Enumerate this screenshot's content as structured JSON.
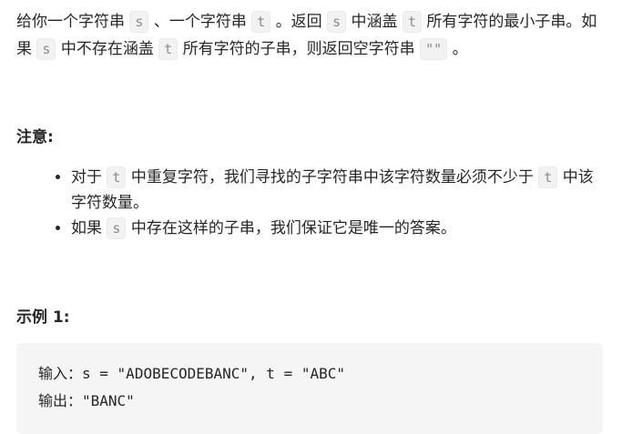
{
  "intro": {
    "t1": "给你一个字符串",
    "s1": "s",
    "t2": "、一个字符串",
    "tvar1": "t",
    "t3": "。返回",
    "s2": "s",
    "t4": "中涵盖",
    "tvar2": "t",
    "t5": "所有字符的最小子串。如果",
    "s3": "s",
    "t6": "中不存在涵盖",
    "tvar3": "t",
    "t7": "所有字符的子串，则返回空字符串",
    "empty": "\"\"",
    "t8": "。"
  },
  "note_heading": "注意:",
  "notes": [
    {
      "a": "对于",
      "c1": "t",
      "b": "中重复字符，我们寻找的子字符串中该字符数量必须不少于",
      "c2": "t",
      "d": "中该字符数量。"
    },
    {
      "a": "如果",
      "c1": "s",
      "b": "中存在这样的子串，我们保证它是唯一的答案。"
    }
  ],
  "example_heading": "示例 1:",
  "example": {
    "input_label": "输入：",
    "input_value": "s = \"ADOBECODEBANC\", t = \"ABC\"",
    "output_label": "输出：",
    "output_value": "\"BANC\""
  }
}
